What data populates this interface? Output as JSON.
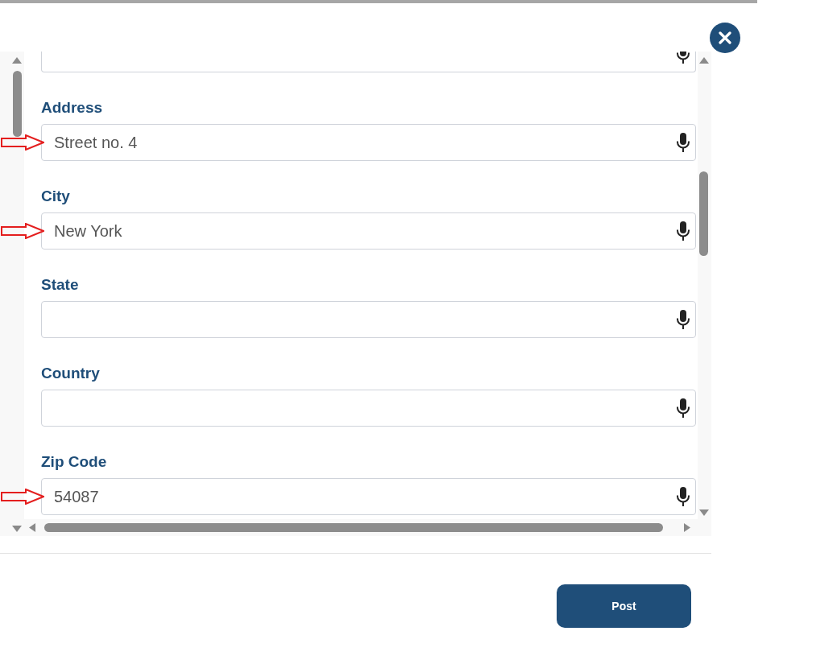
{
  "form": {
    "fields": [
      {
        "kind": "partial"
      },
      {
        "kind": "text",
        "label": "Address",
        "value": "Street no. 4",
        "marked": true
      },
      {
        "kind": "text",
        "label": "City",
        "value": "New York",
        "marked": true
      },
      {
        "kind": "text",
        "label": "State",
        "marked": false
      },
      {
        "kind": "text",
        "label": "Country",
        "marked": false
      },
      {
        "kind": "text",
        "label": "Zip Code",
        "value": "54087",
        "marked": true
      }
    ]
  },
  "actions": {
    "post_button": "Post"
  }
}
